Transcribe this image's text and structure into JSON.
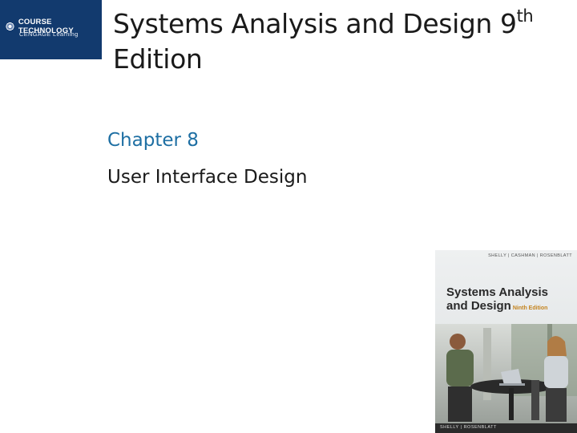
{
  "logo": {
    "line1": "COURSE TECHNOLOGY",
    "line2": "CENGAGE Learning"
  },
  "slide": {
    "title_main": "Systems Analysis and Design  9",
    "title_sup": "th",
    "title_line2": "Edition",
    "chapter": "Chapter 8",
    "subtitle": "User Interface Design"
  },
  "book_cover": {
    "authors": "SHELLY | CASHMAN | ROSENBLATT",
    "title_line1": "Systems Analysis",
    "title_line2": "and Design",
    "edition": "Ninth Edition",
    "bottom_text": "SHELLY | ROSENBLATT"
  }
}
